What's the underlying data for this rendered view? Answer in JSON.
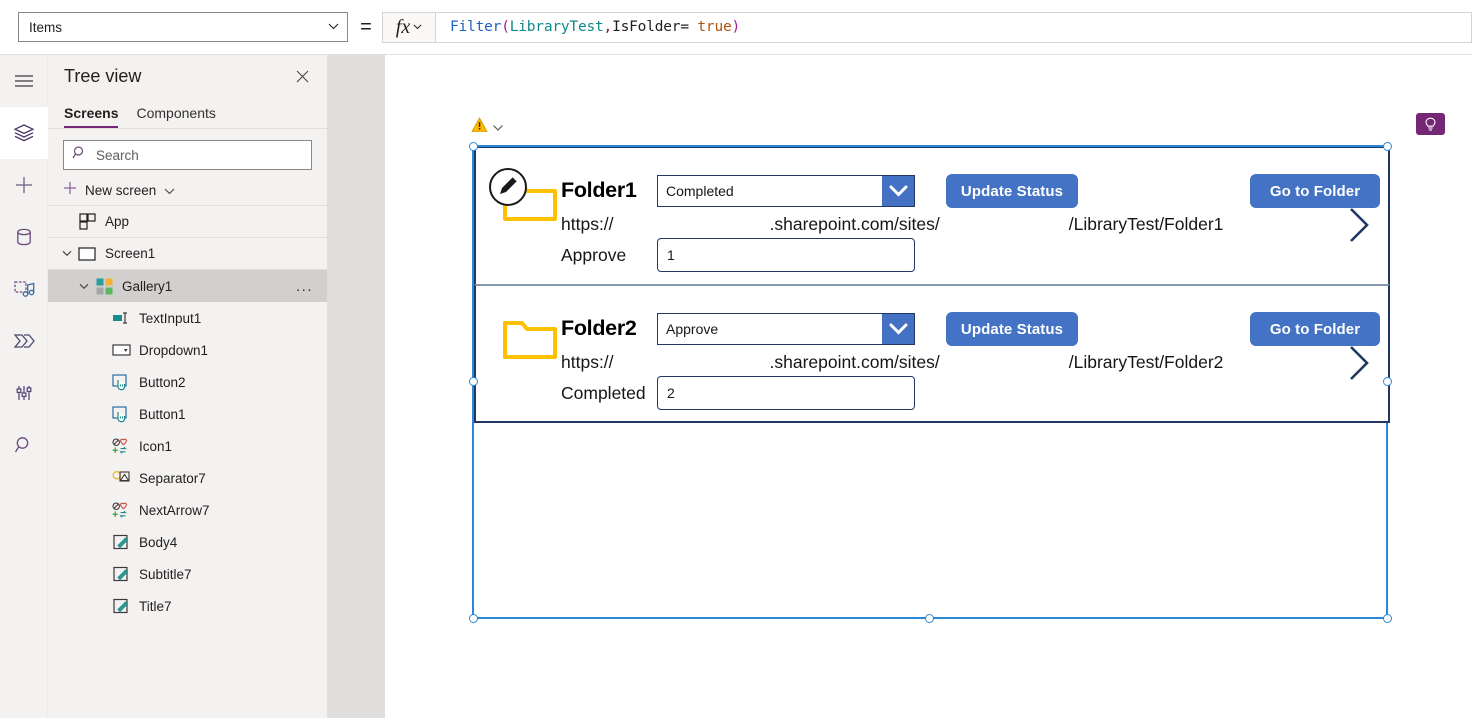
{
  "topbar": {
    "property_selector": {
      "value": "Items",
      "chevron_icon": "chevron-down-icon"
    },
    "equals_sign": "=",
    "fx_label": "fx",
    "fx_chevron_icon": "chevron-down-icon",
    "formula": {
      "full_text": "Filter(LibraryTest,IsFolder= true)",
      "tokens": {
        "fn": "Filter",
        "open_paren": "(",
        "table": "LibraryTest",
        "comma": ",",
        "field": "IsFolder=",
        "space": " ",
        "bool": "true",
        "close_paren": ")"
      }
    }
  },
  "rail": {
    "items": [
      {
        "name": "hamburger-menu-icon",
        "title": "Menu"
      },
      {
        "name": "tree-view-icon",
        "title": "Tree view",
        "active": true
      },
      {
        "name": "insert-plus-icon",
        "title": "Insert"
      },
      {
        "name": "data-database-icon",
        "title": "Data"
      },
      {
        "name": "media-icon",
        "title": "Media"
      },
      {
        "name": "power-automate-icon",
        "title": "Power Automate"
      },
      {
        "name": "variables-icon",
        "title": "Variables"
      },
      {
        "name": "search-icon",
        "title": "Search"
      }
    ]
  },
  "treeview": {
    "title": "Tree view",
    "close_icon": "close-icon",
    "tabs": [
      {
        "label": "Screens",
        "active": true
      },
      {
        "label": "Components",
        "active": false
      }
    ],
    "search": {
      "placeholder": "Search",
      "value": "",
      "icon": "search-icon"
    },
    "new_screen": {
      "label": "New screen",
      "plus_icon": "plus-icon",
      "chevron_icon": "chevron-down-icon"
    },
    "items": [
      {
        "label": "App",
        "icon": "app-icon",
        "indent": 0,
        "twisty": "",
        "selected": false
      },
      {
        "label": "Screen1",
        "icon": "screen-icon",
        "indent": 0,
        "twisty": "down",
        "selected": false
      },
      {
        "label": "Gallery1",
        "icon": "gallery-icon",
        "indent": 1,
        "twisty": "down",
        "selected": true,
        "overflow": "..."
      },
      {
        "label": "TextInput1",
        "icon": "text-input-icon",
        "indent": 2,
        "twisty": "",
        "selected": false
      },
      {
        "label": "Dropdown1",
        "icon": "dropdown-icon",
        "indent": 2,
        "twisty": "",
        "selected": false
      },
      {
        "label": "Button2",
        "icon": "button-icon",
        "indent": 2,
        "twisty": "",
        "selected": false
      },
      {
        "label": "Button1",
        "icon": "button-icon",
        "indent": 2,
        "twisty": "",
        "selected": false
      },
      {
        "label": "Icon1",
        "icon": "icon-shape-icon",
        "indent": 2,
        "twisty": "",
        "selected": false
      },
      {
        "label": "Separator7",
        "icon": "separator-icon",
        "indent": 2,
        "twisty": "",
        "selected": false
      },
      {
        "label": "NextArrow7",
        "icon": "icon-shape-icon",
        "indent": 2,
        "twisty": "",
        "selected": false
      },
      {
        "label": "Body4",
        "icon": "label-icon",
        "indent": 2,
        "twisty": "",
        "selected": false
      },
      {
        "label": "Subtitle7",
        "icon": "label-icon",
        "indent": 2,
        "twisty": "",
        "selected": false
      },
      {
        "label": "Title7",
        "icon": "label-icon",
        "indent": 2,
        "twisty": "",
        "selected": false
      }
    ]
  },
  "canvas": {
    "warning_icon": "warning-triangle-icon",
    "warning_chevron_icon": "chevron-down-icon",
    "lightbulb_badge_icon": "lightbulb-icon",
    "colors": {
      "selection": "#2b88d8",
      "button": "#4472c4",
      "control_border": "#1f3864",
      "folder": "#ffc000",
      "row_divider": "#8496b0"
    },
    "gallery": {
      "name": "Gallery1",
      "rows": [
        {
          "title": "Folder1",
          "folder_icon": "folder-icon",
          "edit_badge_icon": "edit-pencil-icon",
          "dropdown_value": "Completed",
          "dropdown_chevron_icon": "chevron-down-icon",
          "update_button": "Update Status",
          "goto_button": "Go to Folder",
          "url_part1": "https://",
          "url_part2": ".sharepoint.com/sites/",
          "url_part3": "/LibraryTest/Folder1",
          "next_arrow_icon": "chevron-right-icon",
          "field_label": "Approve",
          "field_value": "1"
        },
        {
          "title": "Folder2",
          "folder_icon": "folder-icon",
          "edit_badge_icon": null,
          "dropdown_value": "Approve",
          "dropdown_chevron_icon": "chevron-down-icon",
          "update_button": "Update Status",
          "goto_button": "Go to Folder",
          "url_part1": "https://",
          "url_part2": ".sharepoint.com/sites/",
          "url_part3": "/LibraryTest/Folder2",
          "next_arrow_icon": "chevron-right-icon",
          "field_label": "Completed",
          "field_value": "2"
        }
      ]
    }
  }
}
